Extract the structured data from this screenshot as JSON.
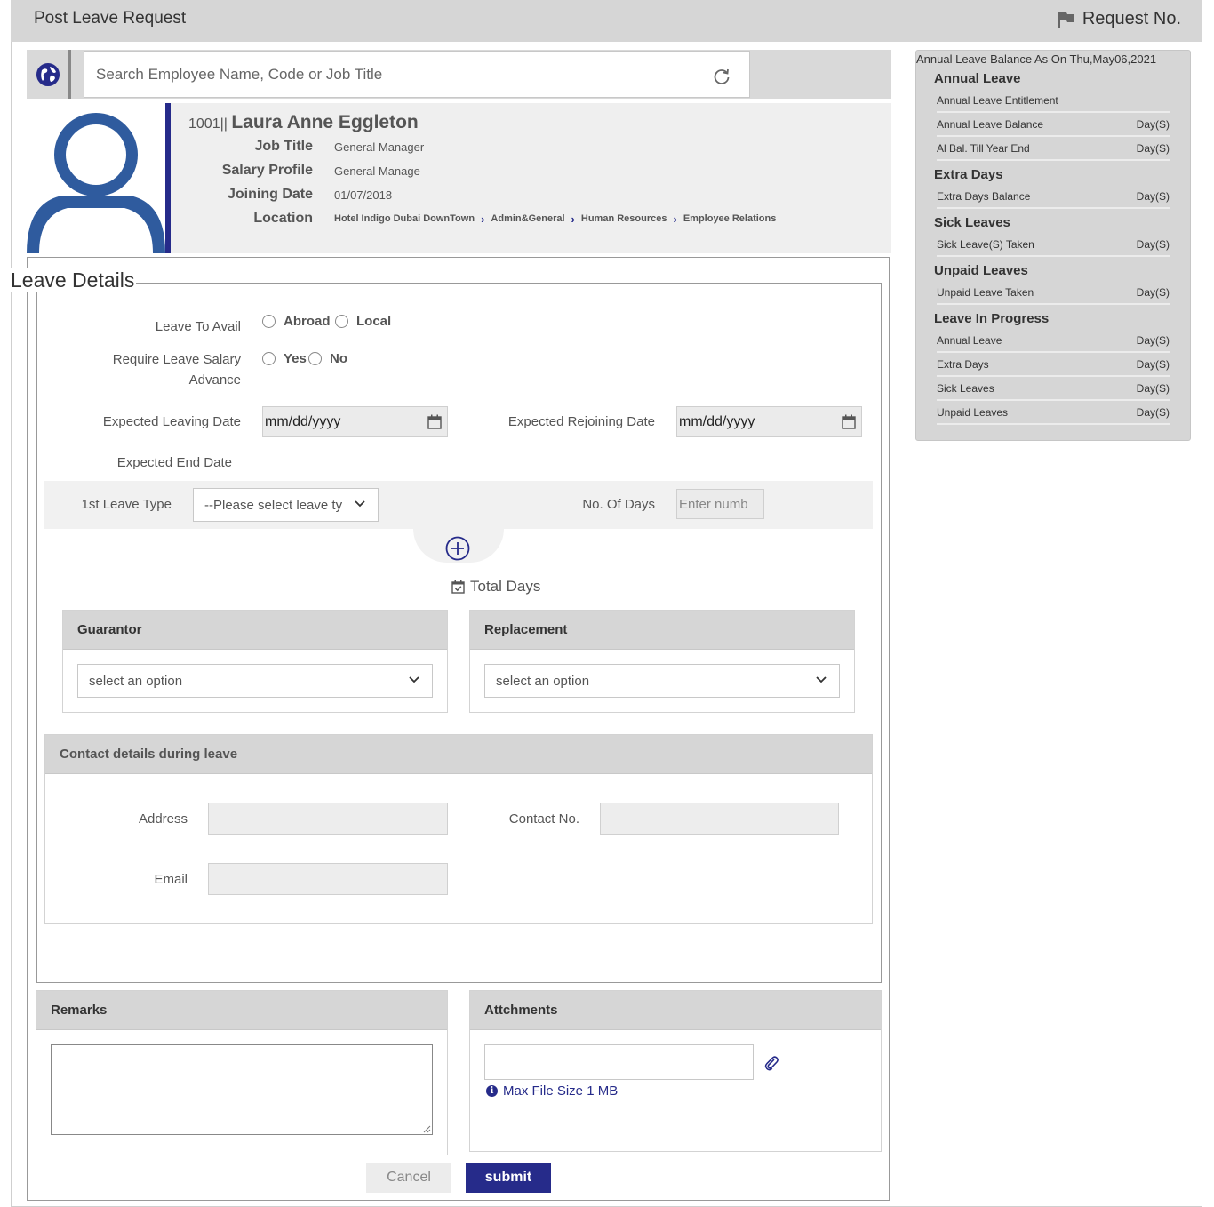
{
  "header": {
    "title": "Post Leave Request",
    "request_no_label": "Request No."
  },
  "search": {
    "placeholder": "Search Employee Name, Code or Job Title"
  },
  "employee": {
    "code": "1001||",
    "name": "Laura Anne Eggleton",
    "fields": [
      {
        "label": "Job Title",
        "value": "General Manager"
      },
      {
        "label": "Salary Profile",
        "value": "General Manage"
      },
      {
        "label": "Joining Date",
        "value": "01/07/2018"
      }
    ],
    "location_label": "Location",
    "location_path": [
      "Hotel Indigo Dubai DownTown",
      "Admin&General",
      "Human Resources",
      "Employee Relations"
    ]
  },
  "balance": {
    "heading": "Annual Leave Balance As On Thu,May06,2021",
    "sections": [
      {
        "title": "Annual Leave",
        "rows": [
          {
            "label": "Annual Leave Entitlement",
            "unit": ""
          },
          {
            "label": "Annual Leave Balance",
            "unit": "Day(S)"
          },
          {
            "label": "Al Bal. Till Year End",
            "unit": "Day(S)"
          }
        ]
      },
      {
        "title": "Extra Days",
        "rows": [
          {
            "label": "Extra Days Balance",
            "unit": "Day(S)"
          }
        ]
      },
      {
        "title": "Sick Leaves",
        "rows": [
          {
            "label": "Sick Leave(S) Taken",
            "unit": "Day(S)"
          }
        ]
      },
      {
        "title": "Unpaid Leaves",
        "rows": [
          {
            "label": "Unpaid Leave Taken",
            "unit": "Day(S)"
          }
        ]
      },
      {
        "title": "Leave In Progress",
        "rows": [
          {
            "label": "Annual Leave",
            "unit": "Day(S)"
          },
          {
            "label": "Extra Days",
            "unit": "Day(S)"
          },
          {
            "label": "Sick Leaves",
            "unit": "Day(S)"
          },
          {
            "label": "Unpaid Leaves",
            "unit": "Day(S)"
          }
        ]
      }
    ]
  },
  "leave_details": {
    "legend": "Leave Details",
    "leave_to_avail": {
      "label": "Leave To Avail",
      "options": [
        "Abroad",
        "Local"
      ]
    },
    "salary_advance": {
      "label_line1": "Require Leave Salary",
      "label_line2": "Advance",
      "options": [
        "Yes",
        "No"
      ]
    },
    "expected_leaving": {
      "label": "Expected Leaving Date",
      "value": "mm/dd/yyyy"
    },
    "expected_rejoining": {
      "label": "Expected Rejoining Date",
      "value": "mm/dd/yyyy"
    },
    "expected_end": {
      "label": "Expected End Date"
    },
    "leave_type": {
      "label": "1st Leave Type",
      "value": "--Please select leave ty"
    },
    "no_of_days": {
      "label": "No. Of Days",
      "placeholder": "Enter numb"
    },
    "total_days": "Total Days",
    "guarantor": {
      "title": "Guarantor",
      "value": "select an option"
    },
    "replacement": {
      "title": "Replacement",
      "value": "select an option"
    },
    "contact": {
      "title": "Contact details during leave",
      "address_label": "Address",
      "contact_label": "Contact No.",
      "email_label": "Email"
    }
  },
  "remarks": {
    "title": "Remarks"
  },
  "attachments": {
    "title": "Attchments",
    "max_size": "Max File Size 1 MB"
  },
  "buttons": {
    "cancel": "Cancel",
    "submit": "submit"
  },
  "colors": {
    "accent": "#262b8a",
    "header_bg": "#d6d6d6"
  }
}
